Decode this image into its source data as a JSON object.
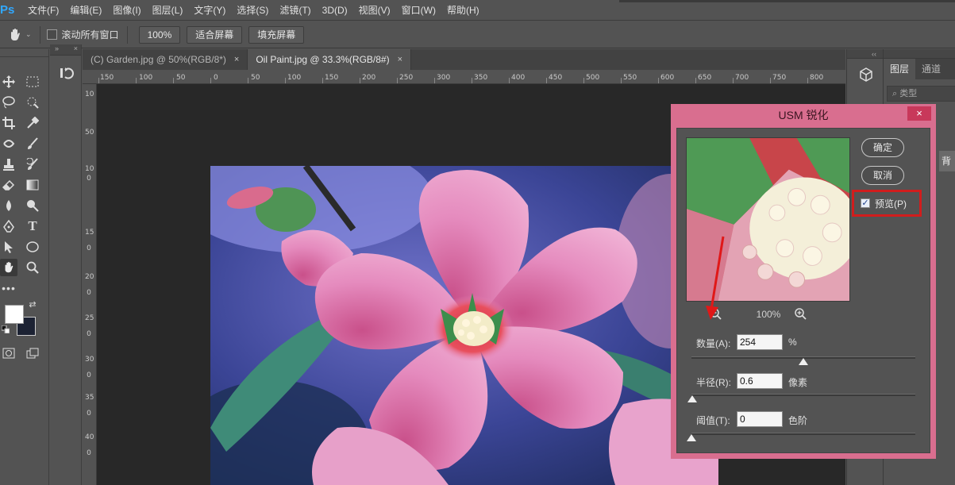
{
  "app": {
    "logo": "Ps"
  },
  "menu": [
    "文件(F)",
    "编辑(E)",
    "图像(I)",
    "图层(L)",
    "文字(Y)",
    "选择(S)",
    "滤镜(T)",
    "3D(D)",
    "视图(V)",
    "窗口(W)",
    "帮助(H)"
  ],
  "options": {
    "scroll_all_label": "滚动所有窗口",
    "zoom_label": "100%",
    "fit_screen_label": "适合屏幕",
    "fill_screen_label": "填充屏幕"
  },
  "tabs": [
    {
      "label": "(C) Garden.jpg @ 50%(RGB/8*)",
      "close": "×"
    },
    {
      "label": "Oil Paint.jpg @ 33.3%(RGB/8#)",
      "close": "×"
    }
  ],
  "ruler_h": [
    "150",
    "100",
    "50",
    "0",
    "50",
    "100",
    "150",
    "200",
    "250",
    "300",
    "350",
    "400",
    "450",
    "500",
    "550",
    "600",
    "650",
    "700",
    "750",
    "800"
  ],
  "ruler_v": [
    "10",
    "50",
    "10",
    "0",
    "15",
    "0",
    "20",
    "0",
    "25",
    "0",
    "30",
    "0",
    "35",
    "0",
    "40",
    "0"
  ],
  "panels": {
    "tab_layers": "图层",
    "tab_channels": "通道",
    "filter_label": "类型",
    "layer_name": "背景"
  },
  "dialog": {
    "title": "USM 锐化",
    "close": "×",
    "ok_label": "确定",
    "cancel_label": "取消",
    "preview_label": "预览(P)",
    "preview_checked": true,
    "zoom_value": "100%",
    "amount_label": "数量(A):",
    "amount_value": "254",
    "amount_unit": "%",
    "amount_level": 0.5,
    "radius_label": "半径(R):",
    "radius_value": "0.6",
    "radius_unit": "像素",
    "radius_level": 0.002,
    "threshold_label": "阈值(T):",
    "threshold_value": "0",
    "threshold_unit": "色阶",
    "threshold_level": 0.0
  },
  "colors": {
    "accent": "#31a8ff",
    "dialog_frame": "#d96e8f",
    "dialog_close": "#c8385a",
    "highlight_red": "#d11d1d",
    "foreground": "#ffffff",
    "background": "#1c2233"
  }
}
